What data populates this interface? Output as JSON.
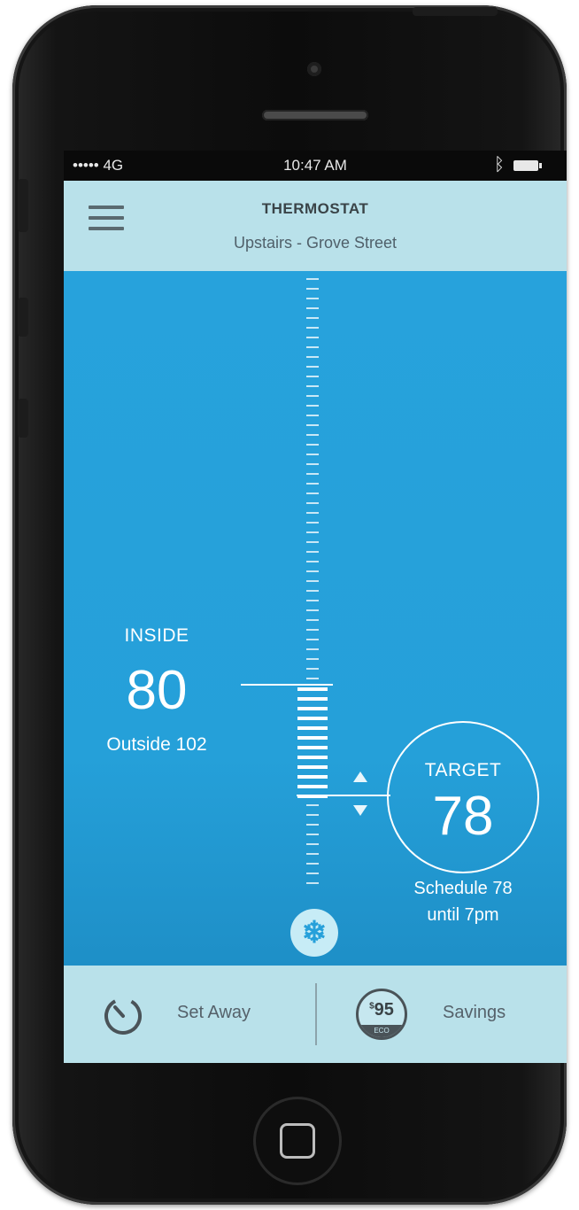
{
  "status_bar": {
    "carrier": "••••• 4G",
    "time": "10:47 AM",
    "bluetooth_icon": "bluetooth-icon",
    "battery_icon": "battery-icon"
  },
  "header": {
    "menu_icon": "hamburger-menu-icon",
    "title": "THERMOSTAT",
    "subtitle": "Upstairs - Grove Street"
  },
  "inside": {
    "label": "INSIDE",
    "value": "80",
    "outside": "Outside 102"
  },
  "target": {
    "label": "TARGET",
    "value": "78",
    "schedule_line1": "Schedule 78",
    "schedule_line2": "until 7pm"
  },
  "mode": {
    "icon": "snowflake-icon",
    "glyph": "❄"
  },
  "bottom_bar": {
    "set_away": {
      "icon": "timer-icon",
      "label": "Set Away"
    },
    "savings": {
      "icon": "eco-savings-icon",
      "currency": "$",
      "amount": "95",
      "tag": "ECO",
      "label": "Savings"
    }
  },
  "colors": {
    "accent": "#26a0da",
    "header_bg": "#b9e1ea",
    "text_dark": "#3a4448"
  }
}
